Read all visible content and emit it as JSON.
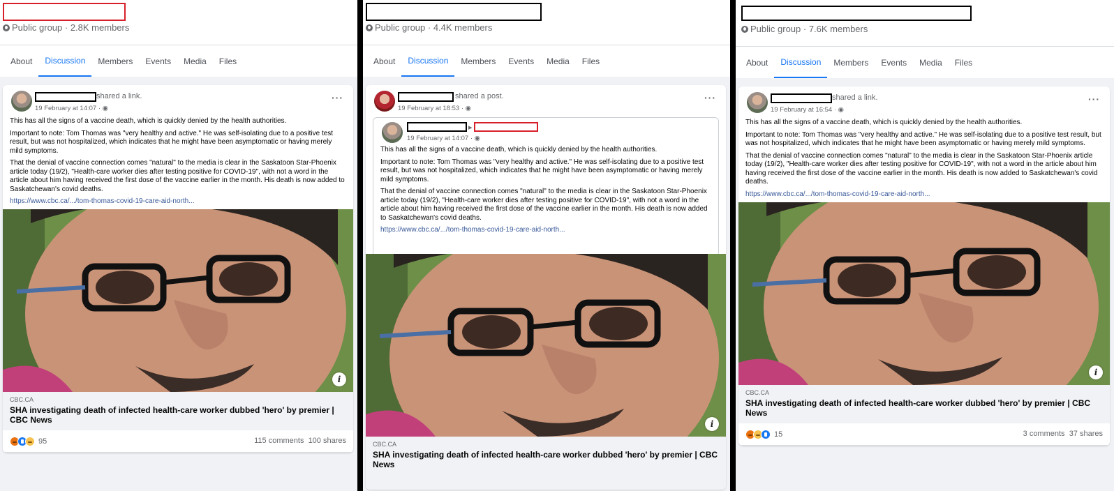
{
  "tabs": [
    "About",
    "Discussion",
    "Members",
    "Events",
    "Media",
    "Files"
  ],
  "active_tab": "Discussion",
  "panels": [
    {
      "group_meta": "Public group · 2.8K members",
      "shared_label": "shared a link.",
      "timestamp": "19 February at 14:07 · ",
      "reaction_count": "95",
      "comments": "115 comments",
      "shares": "100 shares"
    },
    {
      "group_meta": "Public group · 4.4K members",
      "shared_label": "shared a post.",
      "timestamp": "19 February at 18:53 · ",
      "inner_timestamp": "19 February at 14:07 · "
    },
    {
      "group_meta": "Public group · 7.6K members",
      "shared_label": "shared a link.",
      "timestamp": "19 February at 16:54 · ",
      "reaction_count": "15",
      "comments": "3 comments",
      "shares": "37 shares"
    }
  ],
  "post": {
    "para1": "This has all the signs of a vaccine death, which is quickly denied by the health authorities.",
    "para2": "Important to note: Tom Thomas was \"very healthy and active.\" He was self-isolating due to a positive test result, but was not hospitalized, which indicates that he might have been asymptomatic or having merely mild symptoms.",
    "para3": "That the denial of vaccine connection comes \"natural\" to the media is clear in the Saskatoon Star-Phoenix article today (19/2), \"Health-care worker dies after testing positive for COVID-19\", with not a word in the article about him having received the first dose of the vaccine earlier in the month. His death is now added to Saskatchewan's covid deaths.",
    "url": "https://www.cbc.ca/.../tom-thomas-covid-19-care-aid-north...",
    "domain": "CBC.CA",
    "headline": "SHA investigating death of infected health-care worker dubbed 'hero' by premier | CBC News"
  },
  "icons": {
    "more": "more-options-icon",
    "info": "info-icon",
    "globe": "globe-icon",
    "privacy": "privacy-globe-icon"
  },
  "colors": {
    "accent": "#1877f2",
    "redaction_red": "#d8202a",
    "link": "#385898",
    "muted": "#65676b"
  }
}
